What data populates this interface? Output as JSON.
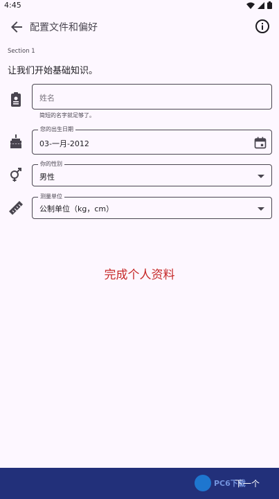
{
  "status_bar": {
    "time": "4:45"
  },
  "app_bar": {
    "title": "配置文件和偏好"
  },
  "section": {
    "label": "Section 1",
    "intro": "让我们开始基础知识。"
  },
  "fields": {
    "name": {
      "placeholder": "姓名",
      "helper": "简短的名字就足够了。"
    },
    "birthdate": {
      "label": "您的出生日期",
      "value": "03-一月-2012"
    },
    "gender": {
      "label": "你的性别",
      "value": "男性"
    },
    "units": {
      "label": "测量单位",
      "value": "公制单位（kg，cm）"
    }
  },
  "center_message": "完成个人资料",
  "bottom_bar": {
    "next_label": "下一个",
    "watermark": "PC6下载"
  },
  "colors": {
    "background": "#fdf7ff",
    "accent_text": "#c62828",
    "bottom_bar": "#22307a"
  }
}
